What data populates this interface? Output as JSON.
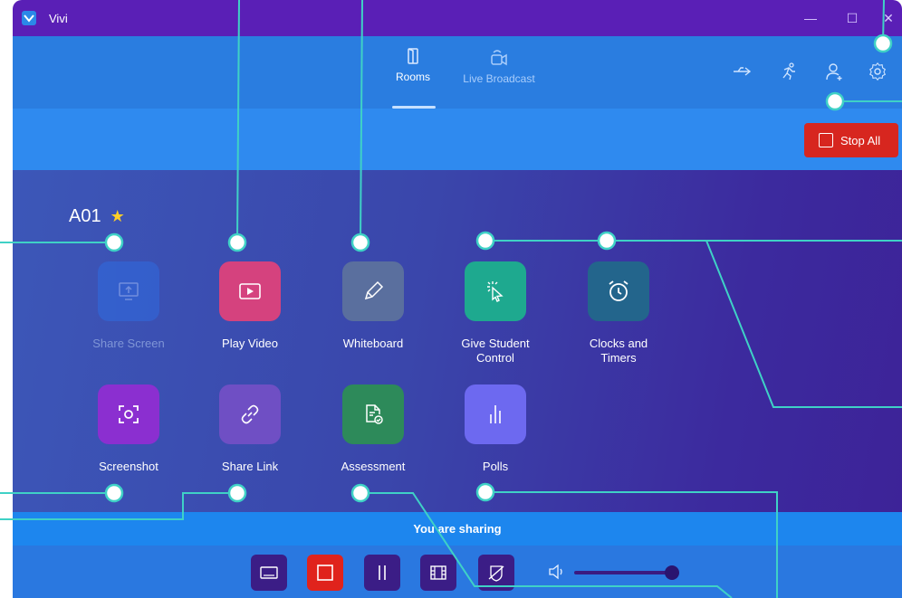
{
  "window": {
    "title": "Vivi"
  },
  "window_controls": {
    "minimize": "—",
    "maximize": "☐",
    "close": "✕"
  },
  "nav": {
    "tabs": [
      {
        "label": "Rooms",
        "icon": "door-icon"
      },
      {
        "label": "Live Broadcast",
        "icon": "broadcast-camera-icon"
      }
    ]
  },
  "header_icons": [
    "usb-icon",
    "running-person-icon",
    "add-user-icon",
    "settings-gear-icon"
  ],
  "stop_all": {
    "label": "Stop All"
  },
  "room": {
    "name": "A01",
    "favorite": true
  },
  "features": [
    {
      "label": "Share Screen",
      "icon": "share-screen-icon",
      "color": "#2f6be0",
      "disabled": true
    },
    {
      "label": "Play Video",
      "icon": "play-video-icon",
      "color": "#d5427e"
    },
    {
      "label": "Whiteboard",
      "icon": "pencil-icon",
      "color": "#5a6f9e"
    },
    {
      "label": "Give Student Control",
      "icon": "cursor-click-icon",
      "color": "#1ea98f"
    },
    {
      "label": "Clocks and Timers",
      "icon": "alarm-clock-icon",
      "color": "#23658c"
    },
    {
      "label": "Screenshot",
      "icon": "screenshot-icon",
      "color": "#8b2fd0"
    },
    {
      "label": "Share Link",
      "icon": "link-icon",
      "color": "#6f4fc4"
    },
    {
      "label": "Assessment",
      "icon": "document-check-icon",
      "color": "#2d8a5a"
    },
    {
      "label": "Polls",
      "icon": "bar-chart-icon",
      "color": "#6d69f0"
    }
  ],
  "sharing": {
    "status": "You are sharing"
  },
  "toolbar": {
    "buttons": [
      {
        "icon": "screen-icon",
        "color": "#3b1d86"
      },
      {
        "icon": "stop-square-icon",
        "color": "#e0231c"
      },
      {
        "icon": "pause-icon",
        "color": "#3b1d86"
      },
      {
        "icon": "film-icon",
        "color": "#3b1d86"
      },
      {
        "icon": "hide-eye-icon",
        "color": "#3b1d86"
      }
    ]
  },
  "volume": {
    "icon": "speaker-icon",
    "level": 0.93
  },
  "colors": {
    "titlebar": "#5a1fb6",
    "navbar": "#2a7de0",
    "accent_red": "#d7261f",
    "callout_line": "#3fd1c6"
  }
}
